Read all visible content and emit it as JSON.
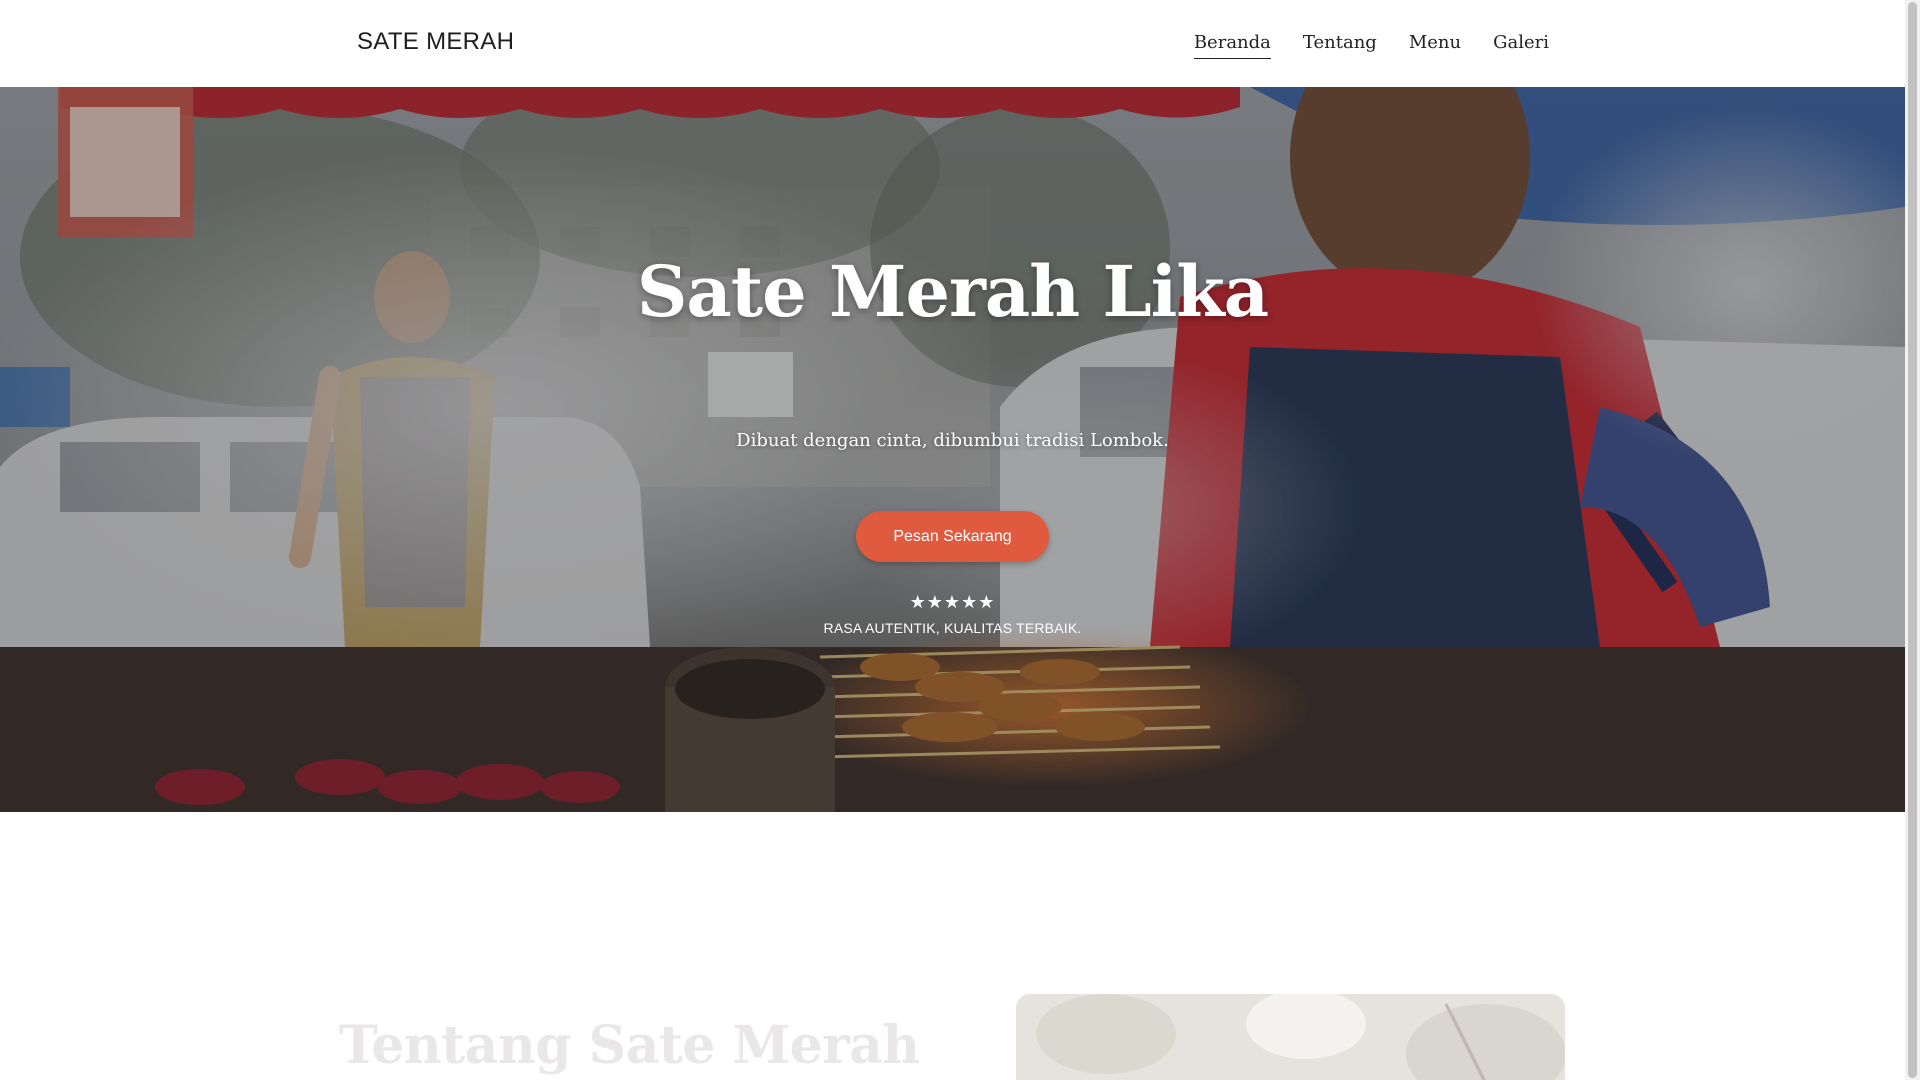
{
  "header": {
    "brand": "SATE MERAH",
    "nav": [
      {
        "label": "Beranda",
        "active": true
      },
      {
        "label": "Tentang",
        "active": false
      },
      {
        "label": "Menu",
        "active": false
      },
      {
        "label": "Galeri",
        "active": false
      }
    ]
  },
  "hero": {
    "title": "Sate Merah Lika",
    "subtitle": "Dibuat dengan cinta, dibumbui tradisi Lombok.",
    "cta_label": "Pesan Sekarang",
    "rating": {
      "stars": "★★★★★",
      "value": 5,
      "max": 5
    },
    "tagline": "RASA AUTENTIK, KUALITAS TERBAIK."
  },
  "about": {
    "title": "Tentang Sate Merah"
  },
  "colors": {
    "accent": "#e05a40",
    "text_dark": "#1e1e1e",
    "hero_text": "#ffffff",
    "about_title": "#e9e7e7"
  },
  "icons": {
    "rating": "star-icon"
  }
}
